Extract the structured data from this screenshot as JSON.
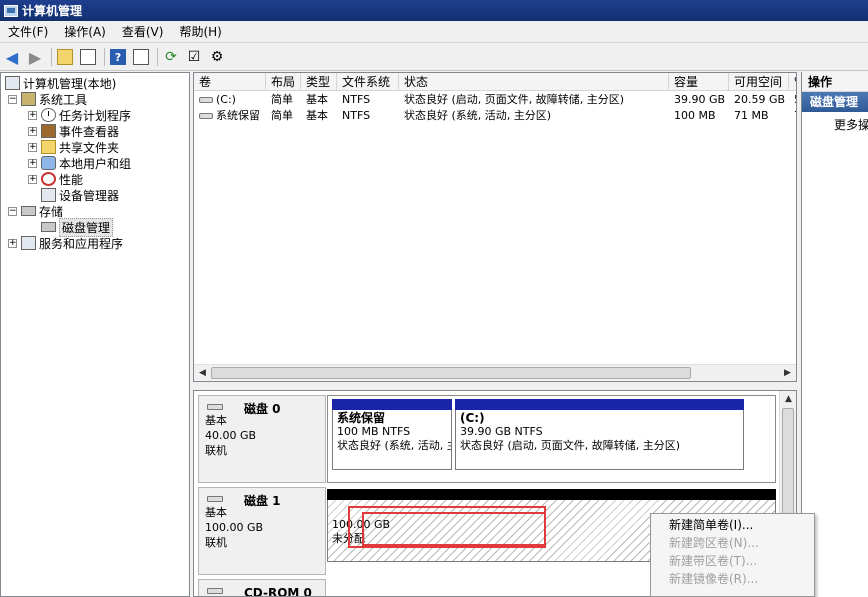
{
  "window": {
    "title": "计算机管理"
  },
  "menu": [
    "文件(F)",
    "操作(A)",
    "查看(V)",
    "帮助(H)"
  ],
  "tree": {
    "root": "计算机管理(本地)",
    "system_tools": "系统工具",
    "task_scheduler": "任务计划程序",
    "event_viewer": "事件查看器",
    "shared_folders": "共享文件夹",
    "local_users": "本地用户和组",
    "performance": "性能",
    "device_manager": "设备管理器",
    "storage": "存储",
    "disk_management": "磁盘管理",
    "services": "服务和应用程序"
  },
  "volume_list": {
    "columns": [
      "卷",
      "布局",
      "类型",
      "文件系统",
      "状态",
      "容量",
      "可用空间",
      "%"
    ],
    "rows": [
      {
        "volume": "(C:)",
        "layout": "简单",
        "type": "基本",
        "fs": "NTFS",
        "status": "状态良好 (启动, 页面文件, 故障转储, 主分区)",
        "capacity": "39.90 GB",
        "free": "20.59 GB",
        "pct": "5"
      },
      {
        "volume": "系统保留",
        "layout": "简单",
        "type": "基本",
        "fs": "NTFS",
        "status": "状态良好 (系统, 活动, 主分区)",
        "capacity": "100 MB",
        "free": "71 MB",
        "pct": "7"
      }
    ]
  },
  "disks": [
    {
      "name": "磁盘 0",
      "type": "基本",
      "size": "40.00 GB",
      "state": "联机",
      "partitions": [
        {
          "title": "系统保留",
          "size_fs": "100 MB NTFS",
          "status": "状态良好 (系统, 活动, 主分区)"
        },
        {
          "title": "(C:)",
          "size_fs": "39.90 GB NTFS",
          "status": "状态良好 (启动, 页面文件, 故障转储, 主分区)"
        }
      ]
    },
    {
      "name": "磁盘 1",
      "type": "基本",
      "size": "100.00 GB",
      "state": "联机",
      "unallocated": {
        "size": "100.00 GB",
        "label": "未分配"
      }
    },
    {
      "name": "CD-ROM 0"
    }
  ],
  "actions": {
    "header": "操作",
    "section": "磁盘管理",
    "more": "更多操作"
  },
  "context_menu": [
    {
      "label": "新建简单卷(I)...",
      "enabled": true
    },
    {
      "label": "新建跨区卷(N)...",
      "enabled": false
    },
    {
      "label": "新建带区卷(T)...",
      "enabled": false
    },
    {
      "label": "新建镜像卷(R)...",
      "enabled": false
    }
  ]
}
